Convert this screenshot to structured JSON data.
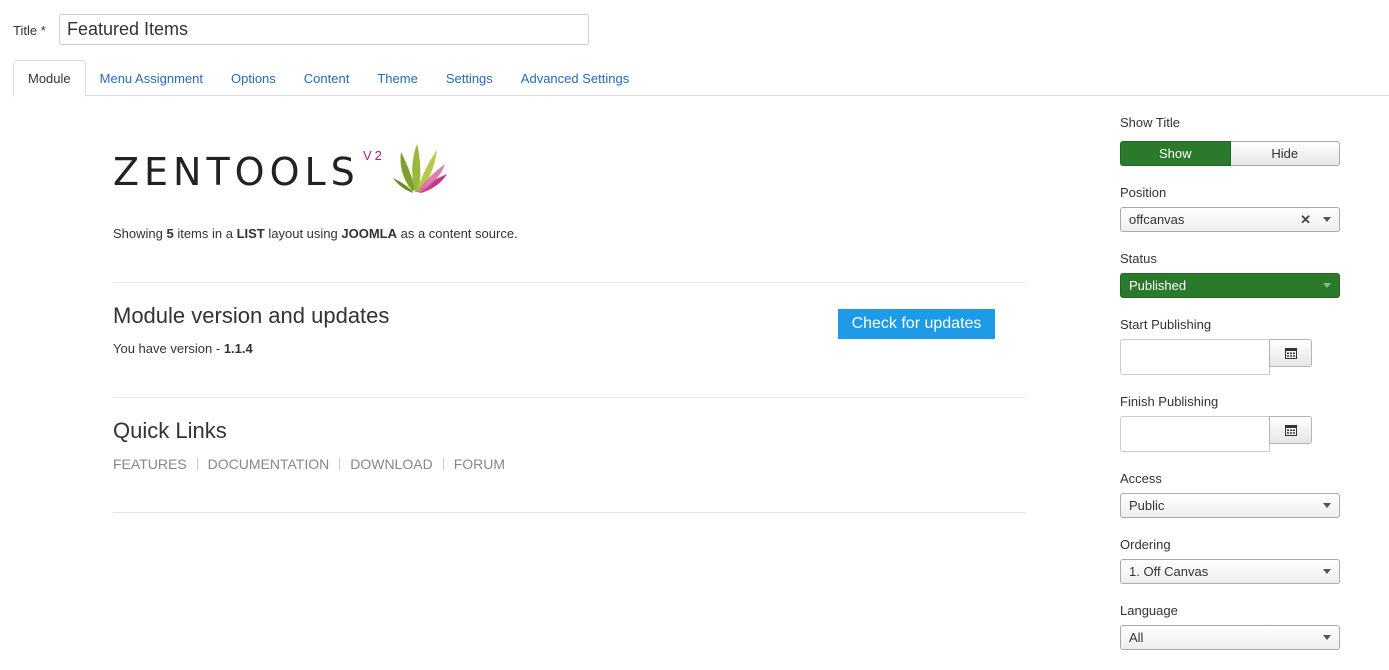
{
  "title_field": {
    "label": "Title *",
    "value": "Featured Items"
  },
  "tabs": [
    {
      "label": "Module",
      "active": true
    },
    {
      "label": "Menu Assignment"
    },
    {
      "label": "Options"
    },
    {
      "label": "Content"
    },
    {
      "label": "Theme"
    },
    {
      "label": "Settings"
    },
    {
      "label": "Advanced Settings"
    }
  ],
  "logo": {
    "text": "ZENTOOLS",
    "version_badge": "V2"
  },
  "summary": {
    "prefix": "Showing ",
    "count": "5",
    "mid1": " items in a ",
    "layout": "LIST",
    "mid2": " layout using ",
    "source": "JOOMLA",
    "suffix": " as a content source."
  },
  "version_section": {
    "heading": "Module version and updates",
    "text_prefix": "You have version - ",
    "version": "1.1.4",
    "button": "Check for updates"
  },
  "quick_links": {
    "heading": "Quick Links",
    "links": [
      "FEATURES",
      "DOCUMENTATION",
      "DOWNLOAD",
      "FORUM"
    ]
  },
  "sidebar": {
    "show_title": {
      "label": "Show Title",
      "show": "Show",
      "hide": "Hide",
      "selected": "Show"
    },
    "position": {
      "label": "Position",
      "value": "offcanvas"
    },
    "status": {
      "label": "Status",
      "value": "Published"
    },
    "start_publishing": {
      "label": "Start Publishing",
      "value": ""
    },
    "finish_publishing": {
      "label": "Finish Publishing",
      "value": ""
    },
    "access": {
      "label": "Access",
      "value": "Public"
    },
    "ordering": {
      "label": "Ordering",
      "value": "1. Off Canvas"
    },
    "language": {
      "label": "Language",
      "value": "All"
    }
  },
  "colors": {
    "tab_link": "#2a69b8",
    "toggle_on": "#2b7a2b",
    "status_published": "#2b7a2b",
    "update_button": "#1e9be6",
    "logo_badge": "#a0256f"
  },
  "icons": {
    "calendar": "calendar-icon",
    "clear": "clear-x-icon",
    "dropdown": "chevron-down-icon",
    "logo_leaf": "leaf-logo-icon"
  }
}
